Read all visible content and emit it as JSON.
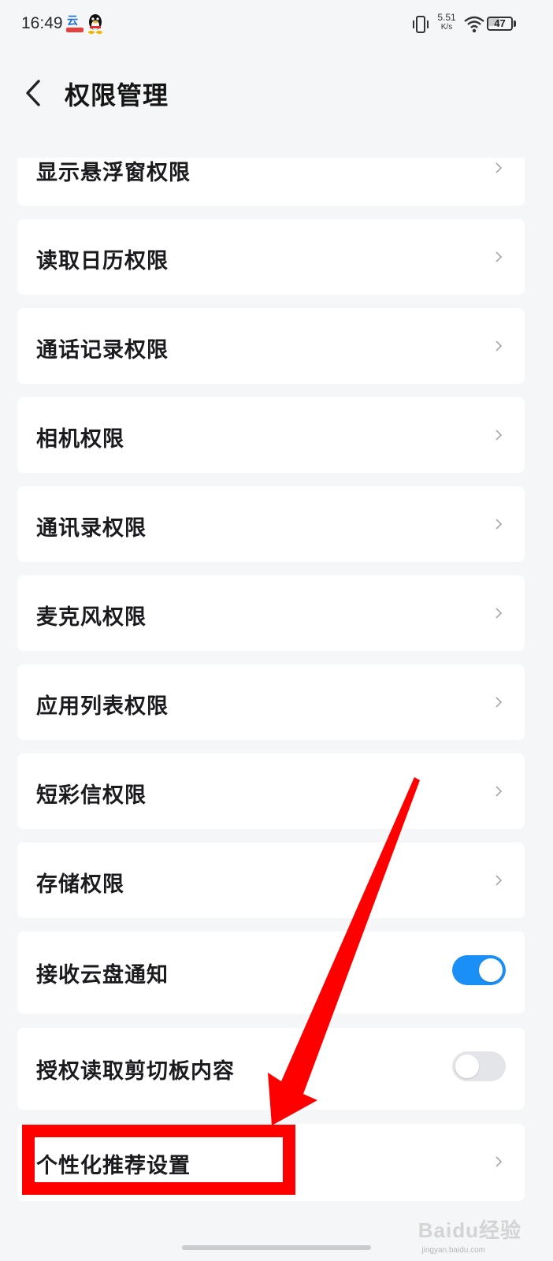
{
  "status_bar": {
    "time": "16:49",
    "app_icons": [
      "cloud-app-icon",
      "qq-penguin-icon"
    ],
    "network_speed": "5.51",
    "network_speed_unit": "K/s",
    "battery_level": "47",
    "battery_fraction": 0.47
  },
  "header": {
    "title": "权限管理",
    "back_icon": "chevron-left-icon"
  },
  "permissions": [
    {
      "label": "显示悬浮窗权限",
      "control": "chevron"
    },
    {
      "label": "读取日历权限",
      "control": "chevron"
    },
    {
      "label": "通话记录权限",
      "control": "chevron"
    },
    {
      "label": "相机权限",
      "control": "chevron"
    },
    {
      "label": "通讯录权限",
      "control": "chevron"
    },
    {
      "label": "麦克风权限",
      "control": "chevron"
    },
    {
      "label": "应用列表权限",
      "control": "chevron"
    },
    {
      "label": "短彩信权限",
      "control": "chevron"
    },
    {
      "label": "存储权限",
      "control": "chevron"
    },
    {
      "label": "接收云盘通知",
      "control": "toggle",
      "enabled": true
    },
    {
      "label": "授权读取剪切板内容",
      "control": "toggle",
      "enabled": false
    },
    {
      "label": "个性化推荐设置",
      "control": "chevron"
    }
  ],
  "colors": {
    "background": "#f5f6f8",
    "card": "#ffffff",
    "toggle_on": "#1a8ff5",
    "toggle_off": "#e3e5e9",
    "annotation_red": "#ff0000"
  },
  "watermark": {
    "text": "Baidu经验",
    "sub": "jingyan.baidu.com"
  }
}
